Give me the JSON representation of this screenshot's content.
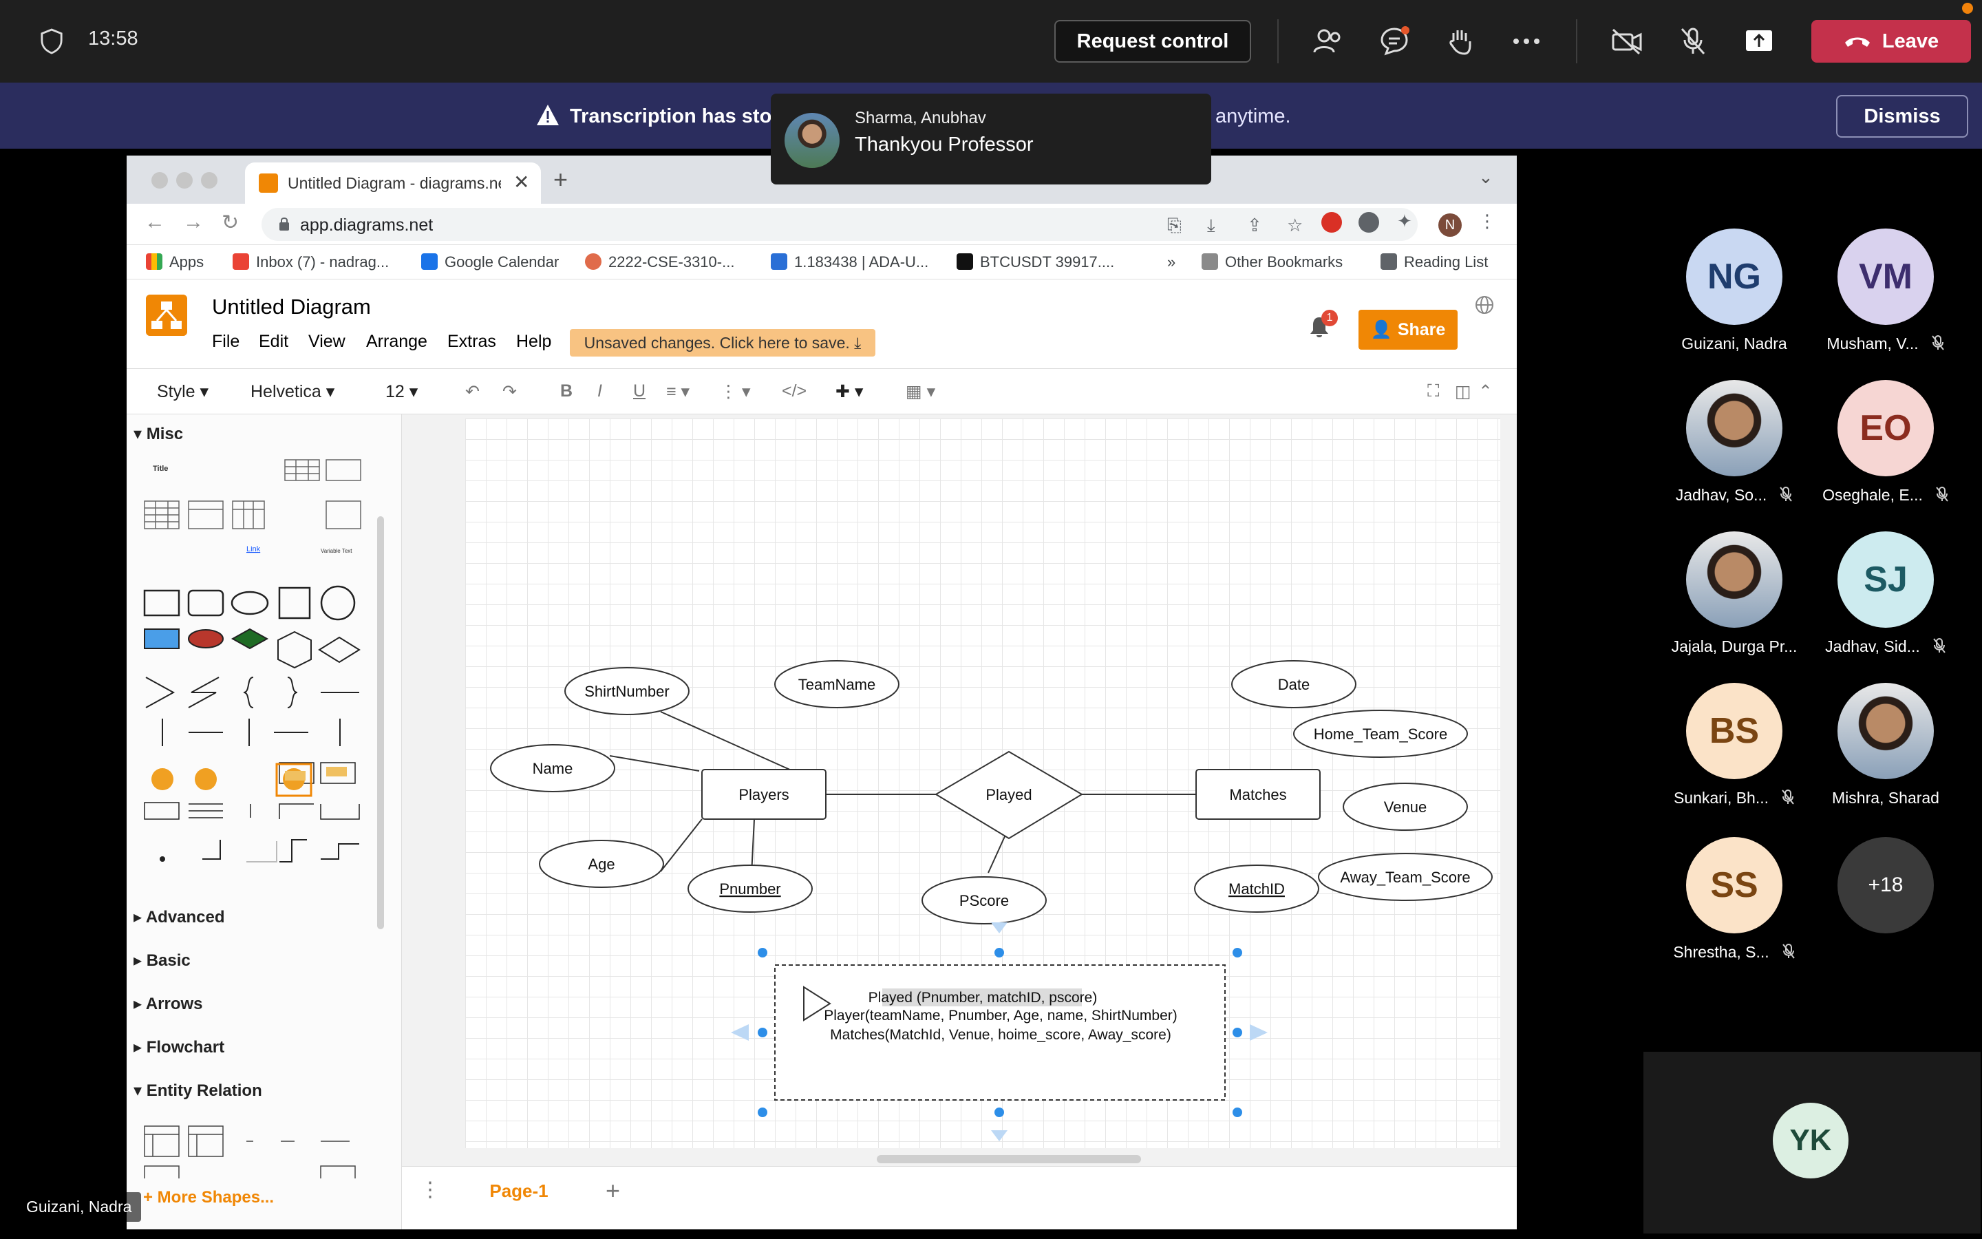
{
  "meeting": {
    "time": "13:58",
    "request_control_label": "Request control",
    "leave_label": "Leave",
    "banner_text_bold": "Transcription has stop",
    "banner_text_rest": "anytime.",
    "dismiss_label": "Dismiss",
    "self_label": "Guizani, Nadra"
  },
  "toast": {
    "sender": "Sharma, Anubhav",
    "message": "Thankyou Professor"
  },
  "browser": {
    "tab_title": "Untitled Diagram - diagrams.ne",
    "url": "app.diagrams.net",
    "profile_initial": "N",
    "bookmarks": [
      "Apps",
      "Inbox (7) - nadrag...",
      "Google Calendar",
      "2222-CSE-3310-...",
      "1.183438 | ADA-U...",
      "BTCUSDT 39917....",
      "»",
      "Other Bookmarks",
      "Reading List"
    ]
  },
  "drawio": {
    "title": "Untitled Diagram",
    "menus": [
      "File",
      "Edit",
      "View",
      "Arrange",
      "Extras",
      "Help"
    ],
    "unsaved_label": "Unsaved changes. Click here to save.",
    "notification_count": "1",
    "share_label": "Share",
    "toolbar": {
      "style": "Style",
      "font": "Helvetica",
      "size": "12",
      "bold": "B",
      "italic": "I",
      "underline": "U"
    },
    "sidebar": {
      "misc": "Misc",
      "advanced": "Advanced",
      "basic": "Basic",
      "arrows": "Arrows",
      "flowchart": "Flowchart",
      "entity_relation": "Entity Relation",
      "more_shapes": "+ More Shapes...",
      "mini_title": "Title",
      "mini_link": "Link",
      "mini_variable": "Variable Text"
    },
    "page_tab": "Page-1"
  },
  "diagram": {
    "entities": [
      "Players",
      "Matches"
    ],
    "relationship": "Played",
    "attributes": {
      "shirt_number": "ShirtNumber",
      "team_name": "TeamName",
      "name": "Name",
      "age": "Age",
      "pnumber": "Pnumber",
      "pscore": "PScore",
      "date": "Date",
      "home_team_score": "Home_Team_Score",
      "venue": "Venue",
      "match_id": "MatchID",
      "away_team_score": "Away_Team_Score"
    },
    "schema_lines": [
      "Played (Pnumber, matchID, pscore)",
      "Player(teamName, Pnumber, Age, name, ShirtNumber)",
      "Matches(MatchId, Venue, hoime_score, Away_score)"
    ]
  },
  "participants": [
    {
      "initials": "NG",
      "name": "Guizani, Nadra",
      "muted": false,
      "bg": "#c9d8f2",
      "fg": "#1f3d6e"
    },
    {
      "initials": "VM",
      "name": "Musham, V...",
      "muted": true,
      "bg": "#d9d2ee",
      "fg": "#3d2e6e"
    },
    {
      "initials": "",
      "name": "Jadhav, So...",
      "muted": true,
      "photo": true
    },
    {
      "initials": "EO",
      "name": "Oseghale, E...",
      "muted": true,
      "bg": "#f6d6d3",
      "fg": "#8b2c1f"
    },
    {
      "initials": "",
      "name": "Jajala, Durga Pr...",
      "muted": false,
      "photo": true
    },
    {
      "initials": "SJ",
      "name": "Jadhav, Sid...",
      "muted": true,
      "bg": "#cdebef",
      "fg": "#1c5a63"
    },
    {
      "initials": "BS",
      "name": "Sunkari, Bh...",
      "muted": true,
      "bg": "#fbe3c8",
      "fg": "#7a4512"
    },
    {
      "initials": "",
      "name": "Mishra, Sharad",
      "muted": false,
      "photo": true
    },
    {
      "initials": "SS",
      "name": "Shrestha, S...",
      "muted": true,
      "bg": "#fbe3c8",
      "fg": "#7a4512"
    },
    {
      "initials": "+18",
      "name": "",
      "muted": false,
      "more": true
    }
  ],
  "bottom_participant": {
    "initials": "YK"
  },
  "colors": {
    "leave": "#c4314b",
    "banner": "#2b2d5e",
    "drawio_orange": "#f08705"
  }
}
